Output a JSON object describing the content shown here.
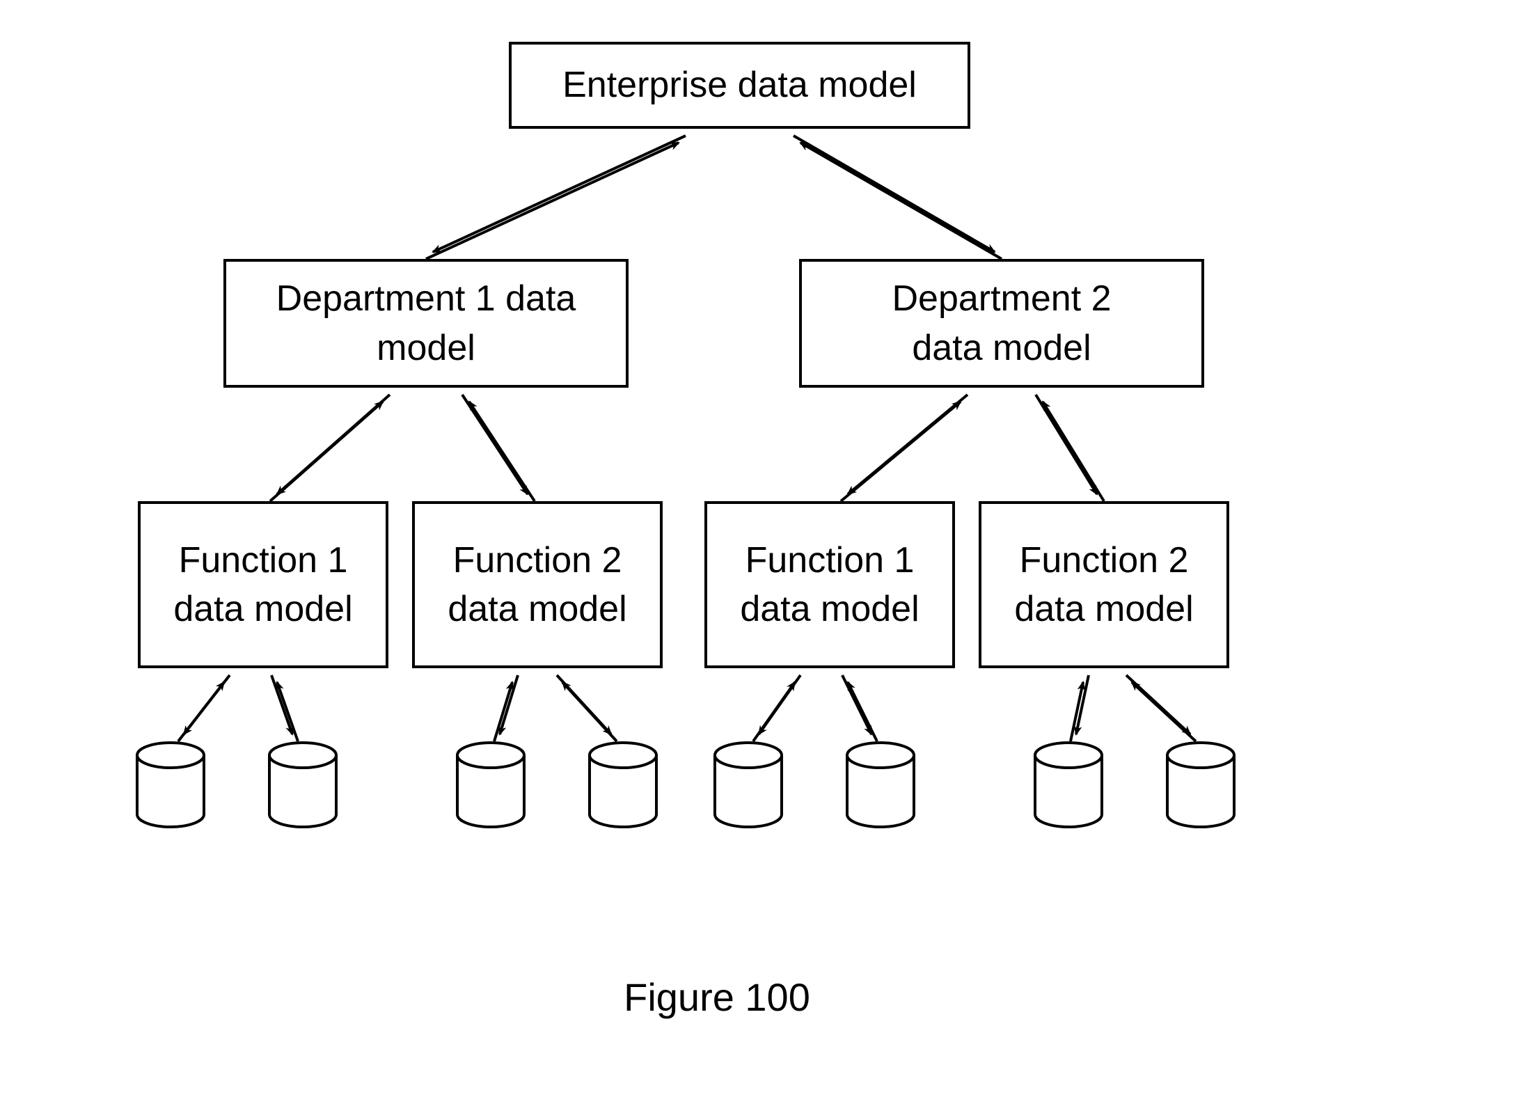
{
  "enterprise": {
    "label": "Enterprise data model"
  },
  "departments": [
    {
      "line1": "Department 1 data",
      "line2": "model"
    },
    {
      "line1": "Department 2",
      "line2": "data model"
    }
  ],
  "functions": [
    {
      "line1": "Function 1",
      "line2": "data model"
    },
    {
      "line1": "Function 2",
      "line2": "data model"
    },
    {
      "line1": "Function 1",
      "line2": "data model"
    },
    {
      "line1": "Function 2",
      "line2": "data model"
    }
  ],
  "caption": "Figure 100"
}
